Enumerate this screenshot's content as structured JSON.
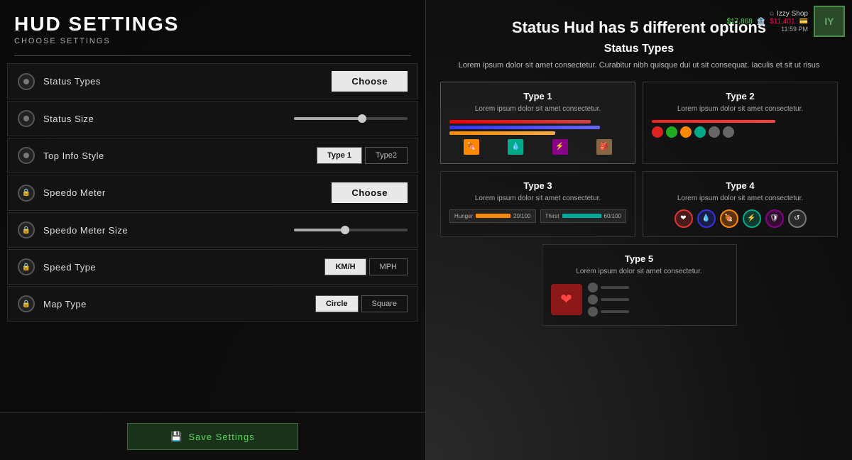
{
  "app": {
    "title": "HUD SETTINGS",
    "subtitle": "CHOOSE SETTINGS"
  },
  "main_heading": "Status Hud has 5 different options",
  "section": {
    "title": "Status Types",
    "description": "Lorem ipsum dolor sit amet consectetur. Curabitur nibh quisque dui ut sit consequat. Iaculis et sit ut risus"
  },
  "menu_items": [
    {
      "id": "status-types",
      "label": "Status Types",
      "action": "choose",
      "icon": "circle"
    },
    {
      "id": "status-size",
      "label": "Status Size",
      "action": "slider",
      "icon": "circle"
    },
    {
      "id": "top-info-style",
      "label": "Top Info Style",
      "action": "toggle",
      "icon": "circle"
    },
    {
      "id": "speedo-meter",
      "label": "Speedo Meter",
      "action": "choose",
      "icon": "lock"
    },
    {
      "id": "speedo-meter-size",
      "label": "Speedo Meter Size",
      "action": "slider",
      "icon": "lock"
    },
    {
      "id": "speed-type",
      "label": "Speed Type",
      "action": "speed-toggle",
      "icon": "lock"
    },
    {
      "id": "map-type",
      "label": "Map Type",
      "action": "map-toggle",
      "icon": "lock"
    }
  ],
  "buttons": {
    "choose": "Choose",
    "save": "Save Settings",
    "type1": "Type 1",
    "type2": "Type2",
    "kmh": "KM/H",
    "mph": "MPH",
    "circle": "Circle",
    "square": "Square"
  },
  "types": [
    {
      "id": "type1",
      "title": "Type 1",
      "desc": "Lorem ipsum dolor sit amet consectetur.",
      "selected": true
    },
    {
      "id": "type2",
      "title": "Type 2",
      "desc": "Lorem ipsum dolor sit amet consectetur."
    },
    {
      "id": "type3",
      "title": "Type 3",
      "desc": "Lorem ipsum dolor sit amet consectetur."
    },
    {
      "id": "type4",
      "title": "Type 4",
      "desc": "Lorem ipsum dolor sit amet consectetur."
    },
    {
      "id": "type5",
      "title": "Type 5",
      "desc": "Lorem ipsum dolor sit amet consectetur."
    }
  ],
  "shop": {
    "username": "Izzy Shop",
    "money1": "$17,868",
    "money2": "$11,401",
    "time": "11:59 PM"
  },
  "sliders": {
    "status_size_pct": 60,
    "speedo_size_pct": 45
  }
}
